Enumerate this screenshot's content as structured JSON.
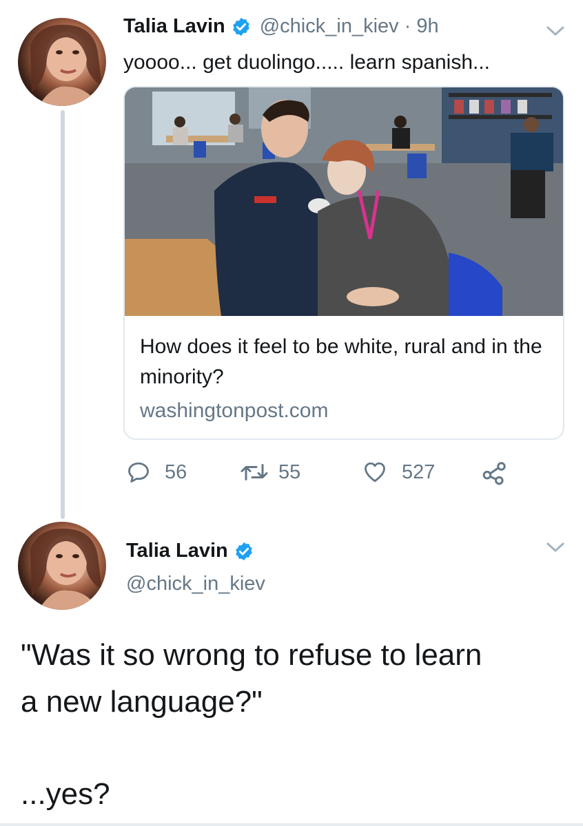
{
  "colors": {
    "primary_text": "#14171a",
    "secondary_text": "#657786",
    "verified_blue": "#1da1f2",
    "divider": "#e1e8ed"
  },
  "tweet1": {
    "author_name": "Talia Lavin",
    "handle": "@chick_in_kiev",
    "separator": "·",
    "time": "9h",
    "text": "yoooo... get duolingo..... learn spanish...",
    "card": {
      "title": "How does it feel to be white, rural and in the minority?",
      "domain": "washingtonpost.com",
      "photo_icon": "news-photo"
    },
    "actions": {
      "reply_count": "56",
      "retweet_count": "55",
      "like_count": "527"
    }
  },
  "tweet2": {
    "author_name": "Talia Lavin",
    "handle": "@chick_in_kiev",
    "text_line1": "\"Was it so wrong to refuse to learn",
    "text_line2": "a new language?\"",
    "text_line3": "...yes?"
  },
  "icons": [
    "verified-badge-icon",
    "chevron-down-icon",
    "reply-icon",
    "retweet-icon",
    "like-icon",
    "share-icon"
  ]
}
